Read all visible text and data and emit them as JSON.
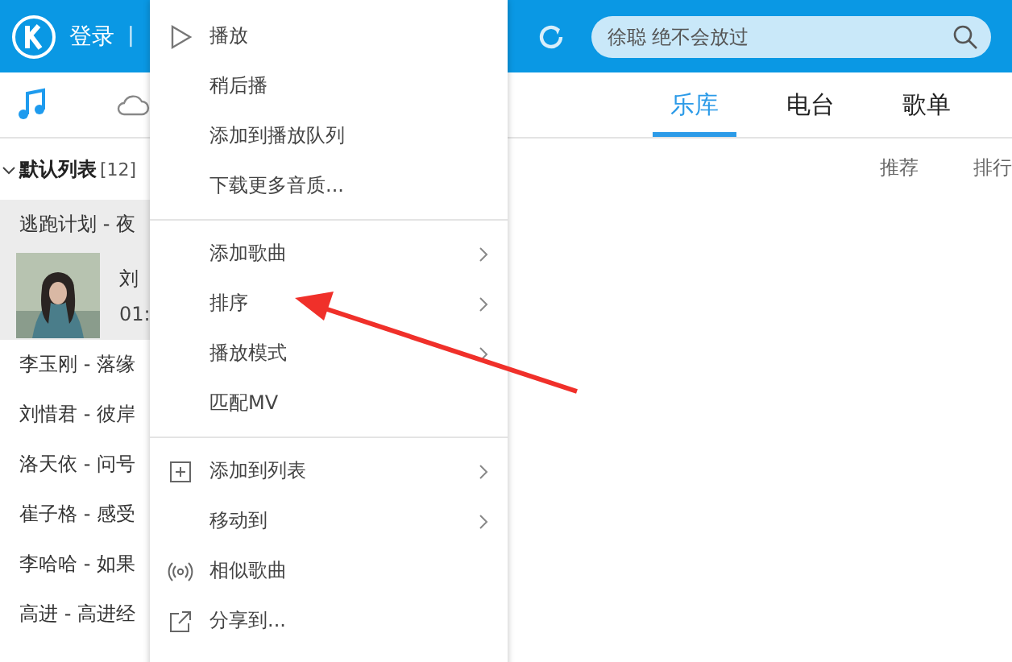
{
  "top_bar": {
    "login": "登录",
    "separator": "|",
    "search": {
      "placeholder": "徐聪 绝不会放过"
    }
  },
  "side_tabs": [
    {
      "kind": "music",
      "selected": true
    },
    {
      "kind": "cloud",
      "selected": false
    }
  ],
  "nav_tabs": [
    {
      "label": "乐库",
      "selected": true
    },
    {
      "label": "电台",
      "selected": false
    },
    {
      "label": "歌单",
      "selected": false
    }
  ],
  "sub_tabs": [
    "推荐",
    "排行"
  ],
  "playlist": {
    "title": "默认列表",
    "count": "[12]",
    "expanded": true,
    "songs": [
      {
        "kind": "text",
        "title": "逃跑计划 - 夜",
        "highlighted": true
      },
      {
        "kind": "playing",
        "title": "刘",
        "time": "01:",
        "highlighted": true
      },
      {
        "kind": "text",
        "title": "李玉刚 - 落缘",
        "highlighted": false
      },
      {
        "kind": "text",
        "title": "刘惜君 - 彼岸",
        "highlighted": false
      },
      {
        "kind": "text",
        "title": "洛天依 - 问号",
        "highlighted": false
      },
      {
        "kind": "text",
        "title": "崔子格 - 感受",
        "highlighted": false
      },
      {
        "kind": "text",
        "title": "李哈哈 - 如果",
        "highlighted": false
      },
      {
        "kind": "text",
        "title": "高进 - 高进经",
        "highlighted": false
      }
    ]
  },
  "context_menu": {
    "items": [
      {
        "kind": "play",
        "label": "播放",
        "submenu": false
      },
      {
        "kind": "plain",
        "label": "稍后播",
        "submenu": false
      },
      {
        "kind": "plain",
        "label": "添加到播放队列",
        "submenu": false
      },
      {
        "kind": "plain",
        "label": "下载更多音质...",
        "submenu": false
      },
      {
        "kind": "divider"
      },
      {
        "kind": "plain",
        "label": "添加歌曲",
        "submenu": true
      },
      {
        "kind": "plain",
        "label": "排序",
        "submenu": true
      },
      {
        "kind": "plain",
        "label": "播放模式",
        "submenu": true
      },
      {
        "kind": "plain",
        "label": "匹配MV",
        "submenu": false
      },
      {
        "kind": "divider"
      },
      {
        "kind": "add",
        "label": "添加到列表",
        "submenu": true
      },
      {
        "kind": "plain",
        "label": "移动到",
        "submenu": true
      },
      {
        "kind": "similar",
        "label": "相似歌曲",
        "submenu": false
      },
      {
        "kind": "share",
        "label": "分享到...",
        "submenu": false
      }
    ]
  }
}
